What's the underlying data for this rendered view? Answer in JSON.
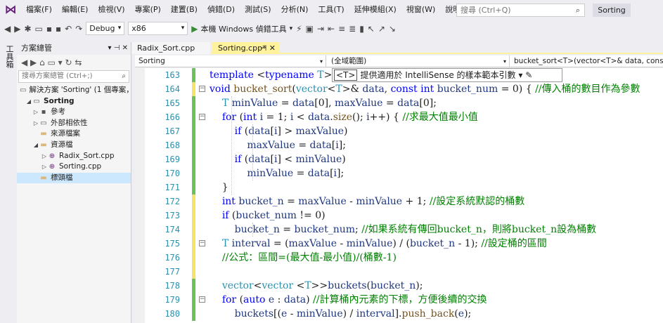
{
  "app": {
    "logo_icon": "visual-studio-logo-icon"
  },
  "menu": [
    "檔案(F)",
    "編輯(E)",
    "檢視(V)",
    "專案(P)",
    "建置(B)",
    "偵錯(D)",
    "測試(S)",
    "分析(N)",
    "工具(T)",
    "延伸模組(X)",
    "視窗(W)",
    "說明(H)"
  ],
  "search": {
    "placeholder": "搜尋 (Ctrl+Q)"
  },
  "solution_title": "Sorting",
  "toolbar": {
    "config": "Debug",
    "platform": "x86",
    "run_label": "本機 Windows 偵錯工具"
  },
  "left_tab": "工具箱",
  "solution_explorer": {
    "title": "方案總管",
    "search_placeholder": "搜尋方案總管 (Ctrl+;)",
    "items": [
      {
        "label": "解決方案 'Sorting' (1 個專案，",
        "icon": "solution-icon",
        "exp": ""
      },
      {
        "label": "Sorting",
        "icon": "project-icon",
        "exp": "◢",
        "bold": true
      },
      {
        "label": "參考",
        "icon": "references-icon",
        "exp": "▷"
      },
      {
        "label": "外部相依性",
        "icon": "dependencies-icon",
        "exp": "▷"
      },
      {
        "label": "來源檔案",
        "icon": "folder-icon",
        "exp": ""
      },
      {
        "label": "資源檔",
        "icon": "folder-icon",
        "exp": "◢"
      },
      {
        "label": "Radix_Sort.cpp",
        "icon": "cpp-file-icon",
        "exp": "▷"
      },
      {
        "label": "Sorting.cpp",
        "icon": "cpp-file-icon",
        "exp": "▷"
      },
      {
        "label": "標頭檔",
        "icon": "folder-icon",
        "exp": ""
      }
    ]
  },
  "tabs": [
    {
      "label": "Radix_Sort.cpp",
      "active": false
    },
    {
      "label": "Sorting.cpp*",
      "active": true
    }
  ],
  "navbar": {
    "project": "Sorting",
    "scope": "(全域範圍)",
    "member": "bucket_sort<T>(vector<T>& data, const"
  },
  "tooltip": {
    "tag": "<T>",
    "text": "提供適用於 IntelliSense 的樣本範本引數"
  },
  "lines": [
    {
      "n": 163,
      "chg": "green",
      "html": "<span class='kw'>template</span> &lt;<span class='kw'>typename</span> <span class='ty'>T</span>&gt;"
    },
    {
      "n": 164,
      "chg": "yellow",
      "fold": "−",
      "html": "<span class='kw'>void</span> <span class='fn'>bucket_sort</span>(<span class='ty'>vector</span>&lt;<span class='ty'>T</span>&gt;&amp; <span class='var'>data</span>, <span class='kw'>const</span> <span class='kw'>int</span> <span class='var'>bucket_num</span> = 0) { <span class='cm'>//傳入桶的數目作為參數</span>"
    },
    {
      "n": 165,
      "chg": "green",
      "html": "    <span class='ty'>T</span> <span class='var'>minValue</span> = <span class='var'>data</span>[0], <span class='var'>maxValue</span> = <span class='var'>data</span>[0];"
    },
    {
      "n": 166,
      "chg": "green",
      "fold": "−",
      "html": "    <span class='kw'>for</span> (<span class='kw'>int</span> <span class='var'>i</span> = 1; <span class='var'>i</span> &lt; <span class='var'>data</span>.<span class='fn'>size</span>(); <span class='var'>i</span>++) { <span class='cm'>//求最大值最小值</span>"
    },
    {
      "n": 167,
      "chg": "green",
      "html": "        <span class='kw'>if</span> (<span class='var'>data</span>[<span class='var'>i</span>] &gt; <span class='var'>maxValue</span>)"
    },
    {
      "n": 168,
      "chg": "green",
      "html": "            <span class='var'>maxValue</span> = <span class='var'>data</span>[<span class='var'>i</span>];"
    },
    {
      "n": 169,
      "chg": "green",
      "html": "        <span class='kw'>if</span> (<span class='var'>data</span>[<span class='var'>i</span>] &lt; <span class='var'>minValue</span>)"
    },
    {
      "n": 170,
      "chg": "green",
      "html": "            <span class='var'>minValue</span> = <span class='var'>data</span>[<span class='var'>i</span>];"
    },
    {
      "n": 171,
      "chg": "green",
      "html": "    }"
    },
    {
      "n": 172,
      "chg": "yellow",
      "html": "    <span class='kw'>int</span> <span class='var'>bucket_n</span> = <span class='var'>maxValue</span> - <span class='var'>minValue</span> + 1; <span class='cm'>//設定系統默認的桶數</span>"
    },
    {
      "n": 173,
      "chg": "yellow",
      "html": "    <span class='kw'>if</span> (<span class='var'>bucket_num</span> != 0)"
    },
    {
      "n": 174,
      "chg": "yellow",
      "html": "        <span class='var'>bucket_n</span> = <span class='var'>bucket_num</span>; <span class='cm'>//如果系統有傳回bucket_n，則將bucket_n設為桶數</span>"
    },
    {
      "n": 175,
      "chg": "yellow",
      "fold": "−",
      "html": "    <span class='ty'>T</span> <span class='var'>interval</span> = (<span class='var'>maxValue</span> - <span class='var'>minValue</span>) / (<span class='var'>bucket_n</span> - 1); <span class='cm'>//設定桶的區間</span>"
    },
    {
      "n": 176,
      "chg": "yellow",
      "html": "    <span class='cm'>//公式：區間=(最大值-最小值)/(桶數-1)</span>"
    },
    {
      "n": 177,
      "chg": "yellow",
      "html": ""
    },
    {
      "n": 178,
      "chg": "green",
      "html": "    <span class='ty'>vector</span>&lt;<span class='ty'>vector</span> &lt;<span class='ty'>T</span>&gt;&gt;<span class='var'>buckets</span>(<span class='var'>bucket_n</span>);"
    },
    {
      "n": 179,
      "chg": "green",
      "fold": "−",
      "html": "    <span class='kw'>for</span> (<span class='kw'>auto</span> <span class='var'>e</span> : <span class='var'>data</span>) <span class='cm'>//計算桶內元素的下標，方便後續的交換</span>"
    },
    {
      "n": 180,
      "chg": "green",
      "html": "        <span class='var'>buckets</span>[(<span class='var'>e</span> - <span class='var'>minValue</span>) / <span class='var'>interval</span>].<span class='fn'>push_back</span>(<span class='var'>e</span>);"
    }
  ]
}
